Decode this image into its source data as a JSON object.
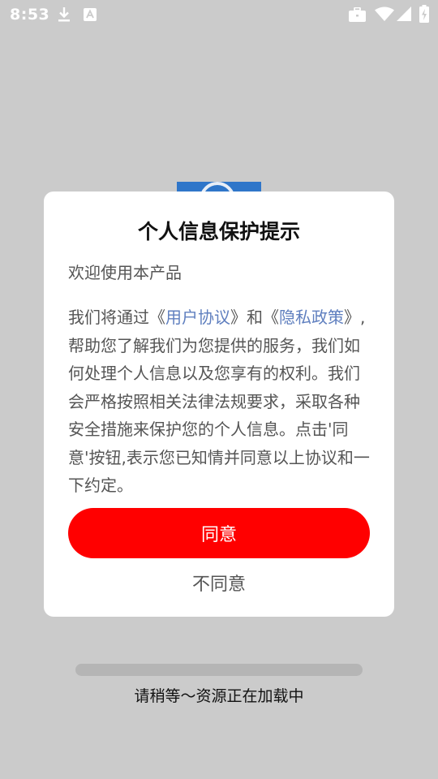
{
  "status_bar": {
    "time": "8:53",
    "icons": [
      "download-icon",
      "font-notification-icon",
      "briefcase-icon",
      "wifi-icon",
      "signal-icon",
      "battery-charging-icon"
    ]
  },
  "dialog": {
    "title": "个人信息保护提示",
    "welcome": "欢迎使用本产品",
    "body": {
      "p1": "我们将通过《",
      "user_agreement": "用户协议",
      "p2": "》和《",
      "privacy_policy": "隐私政策",
      "p3": "》,帮助您了解我们为您提供的服务，我们如何处理个人信息以及您享有的权利。我们会严格按照相关法律法规要求，采取各种安全措施来保护您的个人信息。点击'同意'按钮,表示您已知情并同意以上协议和一下约定。"
    },
    "agree_label": "同意",
    "disagree_label": "不同意"
  },
  "loading": {
    "text": "请稍等～资源正在加载中",
    "progress": 0
  },
  "colors": {
    "background": "#cbcbcb",
    "accent": "#ff0000",
    "link": "#5f7fbf",
    "logo": "#2f76c9"
  }
}
